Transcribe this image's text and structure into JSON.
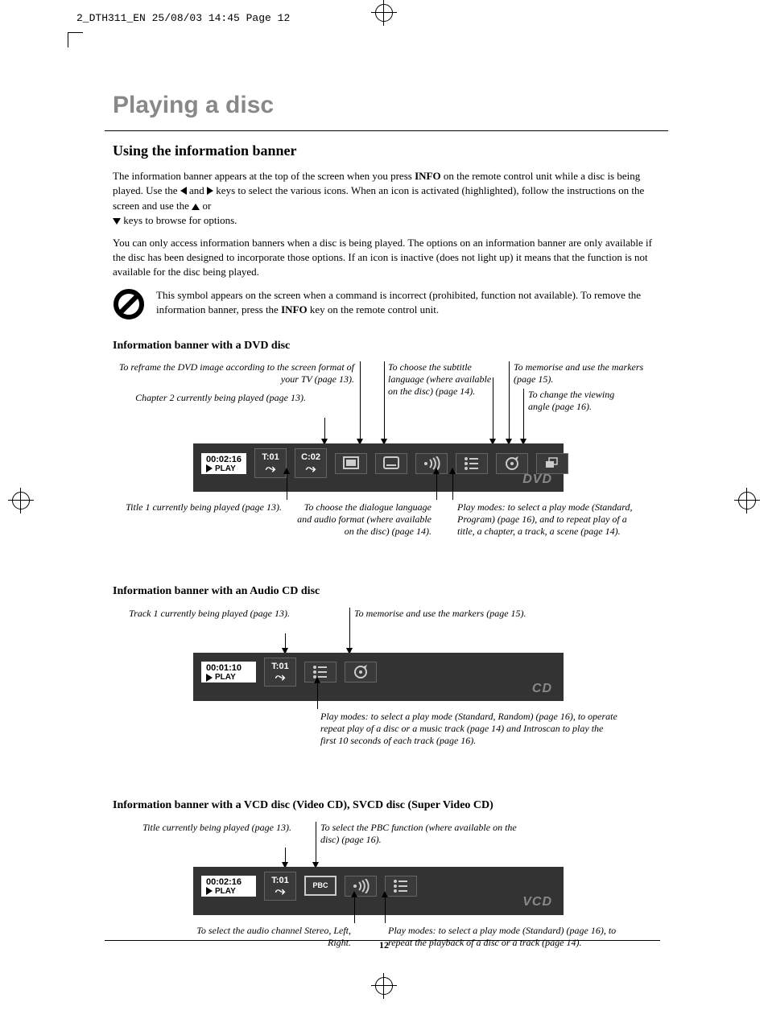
{
  "crop_header": "2_DTH311_EN  25/08/03  14:45  Page 12",
  "page_number": "12",
  "h1": "Playing a disc",
  "h2": "Using the information banner",
  "para1_a": "The information banner appears at the top of the screen when you press ",
  "para1_info": "INFO",
  "para1_b": " on the remote control unit while a disc is being played. Use the ",
  "para1_c": " and ",
  "para1_d": " keys to select the various icons. When an icon is activated (highlighted), follow the instructions on the screen and use the ",
  "para1_e": " or ",
  "para1_f": " keys to browse for options.",
  "para2": "You can only access information banners when a disc is being played. The options on an information banner are only available if the disc has been designed to incorporate those options. If an icon is inactive (does not light up) it means that the function is not available for the disc being played.",
  "note_a": "This symbol appears on the screen when a command is incorrect (prohibited, function not available). To remove the information banner, press the ",
  "note_info": "INFO",
  "note_b": " key on the remote control unit.",
  "dvd": {
    "heading": "Information banner with a DVD disc",
    "time": "00:02:16",
    "play": "PLAY",
    "t_label": "T:01",
    "c_label": "C:02",
    "brand": "DVD",
    "callouts": {
      "reframe": "To reframe the DVD image according to the screen format of your TV (page 13).",
      "chapter": "Chapter 2 currently being played (page 13).",
      "subtitle": "To choose the subtitle language (where available on the disc) (page 14).",
      "markers": "To memorise and use the markers (page 15).",
      "angle": "To change the viewing angle (page 16).",
      "title": "Title 1 currently being played (page 13).",
      "dialogue": "To choose the dialogue language and audio format (where available on the disc) (page 14).",
      "playmodes": "Play modes: to select a play mode (Standard, Program) (page 16), and to repeat play of a title, a chapter, a track, a scene (page 14)."
    }
  },
  "cd": {
    "heading": "Information banner with an Audio CD disc",
    "time": "00:01:10",
    "play": "PLAY",
    "t_label": "T:01",
    "brand": "CD",
    "callouts": {
      "track": "Track 1 currently being played (page 13).",
      "markers": "To memorise and use the markers (page 15).",
      "playmodes": "Play modes: to select a play mode (Standard, Random) (page 16), to operate repeat play of a disc or a music track (page 14) and Introscan to play the first 10 seconds of each track (page 16)."
    }
  },
  "vcd": {
    "heading": "Information banner with a VCD disc (Video CD), SVCD disc (Super Video CD)",
    "time": "00:02:16",
    "play": "PLAY",
    "t_label": "T:01",
    "pbc": "PBC",
    "brand": "VCD",
    "callouts": {
      "title": "Title currently being played (page 13).",
      "pbc": "To select the PBC function (where available on the disc) (page 16).",
      "audio": "To select the audio channel Stereo, Left, Right.",
      "playmodes": "Play modes: to select a play mode (Standard) (page 16), to repeat the playback of a disc or a track (page 14)."
    }
  }
}
